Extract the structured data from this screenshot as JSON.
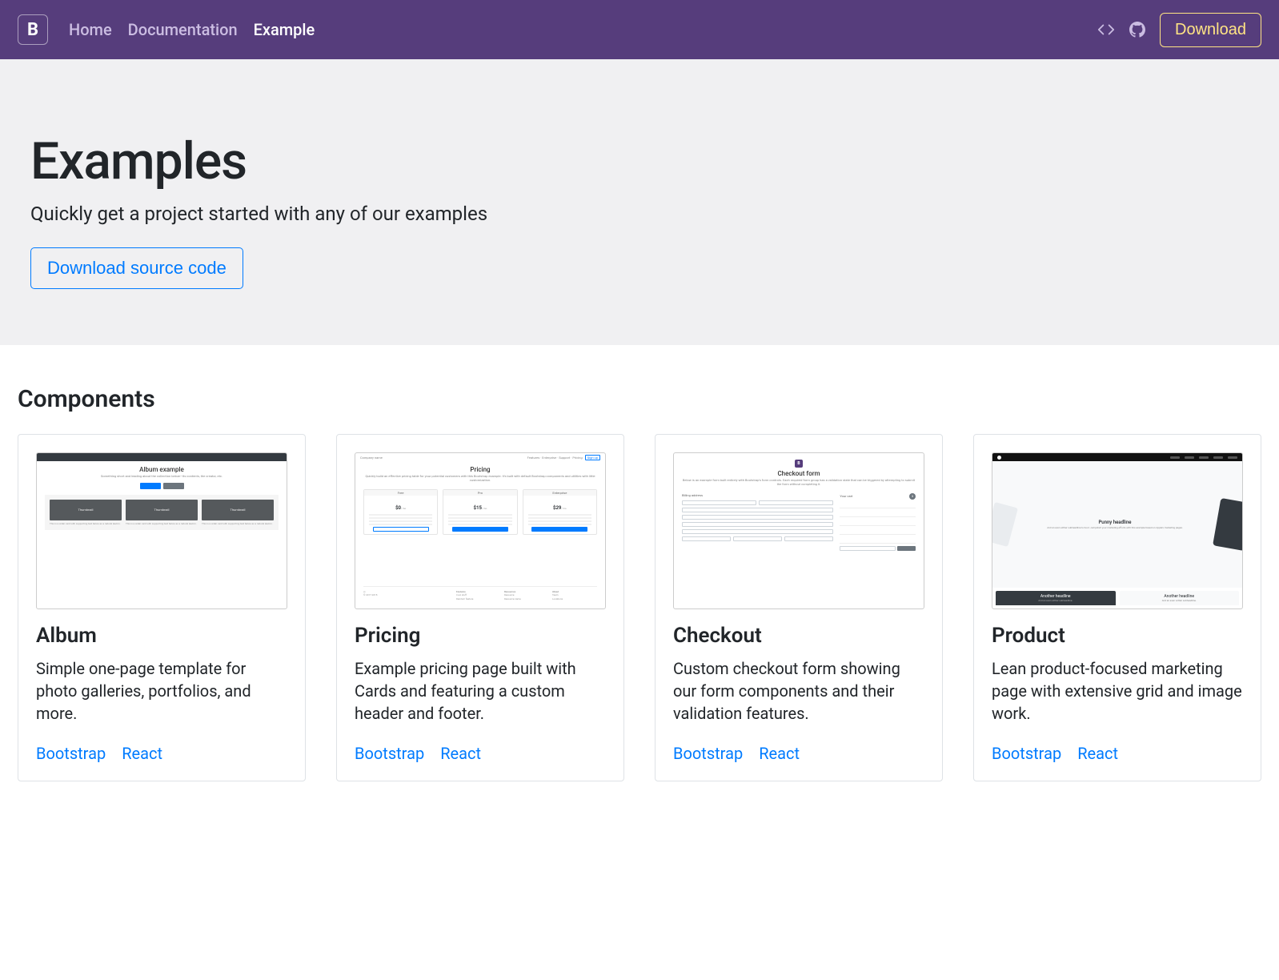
{
  "nav": {
    "brand_letter": "B",
    "links": [
      {
        "label": "Home",
        "active": false
      },
      {
        "label": "Documentation",
        "active": false
      },
      {
        "label": "Example",
        "active": true
      }
    ],
    "download_label": "Download"
  },
  "hero": {
    "title": "Examples",
    "subtitle": "Quickly get a project started with any of our examples",
    "cta_label": "Download source code"
  },
  "section": {
    "title": "Components"
  },
  "cards": [
    {
      "title": "Album",
      "desc": "Simple one-page template for photo galleries, portfolios, and more.",
      "links": [
        "Bootstrap",
        "React"
      ],
      "thumb": {
        "kind": "album",
        "title": "Album example",
        "tile_label": "Thumbnail"
      }
    },
    {
      "title": "Pricing",
      "desc": "Example pricing page built with Cards and featuring a custom header and footer.",
      "links": [
        "Bootstrap",
        "React"
      ],
      "thumb": {
        "kind": "pricing",
        "title": "Pricing",
        "tiers": [
          {
            "name": "Free",
            "price": "$0",
            "unit": "/ mo"
          },
          {
            "name": "Pro",
            "price": "$15",
            "unit": "/ mo"
          },
          {
            "name": "Enterprise",
            "price": "$29",
            "unit": "/ mo"
          }
        ],
        "footer_cols": [
          "",
          "Features",
          "Resources",
          "About"
        ]
      }
    },
    {
      "title": "Checkout",
      "desc": "Custom checkout form showing our form components and their validation features.",
      "links": [
        "Bootstrap",
        "React"
      ],
      "thumb": {
        "kind": "checkout",
        "title": "Checkout form",
        "billing_label": "Billing address",
        "cart_label": "Your cart",
        "cart_count": "3"
      }
    },
    {
      "title": "Product",
      "desc": "Lean product-focused marketing page with extensive grid and image work.",
      "links": [
        "Bootstrap",
        "React"
      ],
      "thumb": {
        "kind": "product",
        "headline": "Punny headline",
        "sub_headline": "Another headline"
      }
    }
  ]
}
